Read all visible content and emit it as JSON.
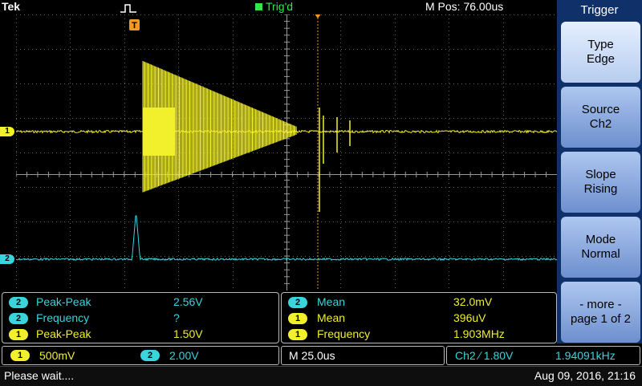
{
  "top": {
    "brand": "Tek",
    "trigger_status": "Trig'd",
    "position": "M Pos: 76.00us"
  },
  "channels": {
    "ch1": {
      "marker": "1",
      "color": "#f2ef2c"
    },
    "ch2": {
      "marker": "2",
      "color": "#3ad4dc"
    }
  },
  "trigger_marker": "T",
  "menu": {
    "title": "Trigger",
    "buttons": [
      {
        "line1": "Type",
        "line2": "Edge"
      },
      {
        "line1": "Source",
        "line2": "Ch2"
      },
      {
        "line1": "Slope",
        "line2": "Rising"
      },
      {
        "line1": "Mode",
        "line2": "Normal"
      },
      {
        "line1": "- more -",
        "line2": "page 1 of 2"
      }
    ]
  },
  "measurements": {
    "left": [
      {
        "ch": "2",
        "name": "Peak-Peak",
        "value": "2.56V"
      },
      {
        "ch": "2",
        "name": "Frequency",
        "value": "?"
      },
      {
        "ch": "1",
        "name": "Peak-Peak",
        "value": "1.50V"
      }
    ],
    "right": [
      {
        "ch": "2",
        "name": "Mean",
        "value": "32.0mV"
      },
      {
        "ch": "1",
        "name": "Mean",
        "value": "396uV"
      },
      {
        "ch": "1",
        "name": "Frequency",
        "value": "1.903MHz"
      }
    ]
  },
  "status": {
    "ch1_badge": "1",
    "ch1_scale": "500mV",
    "ch2_badge": "2",
    "ch2_scale": "2.00V",
    "horizontal": "M 25.0us",
    "trigger_summary": "Ch2 ∕ 1.80V",
    "trigger_frequency": "1.94091kHz",
    "message": "Please wait....",
    "datetime": "Aug 09, 2016, 21:16"
  }
}
